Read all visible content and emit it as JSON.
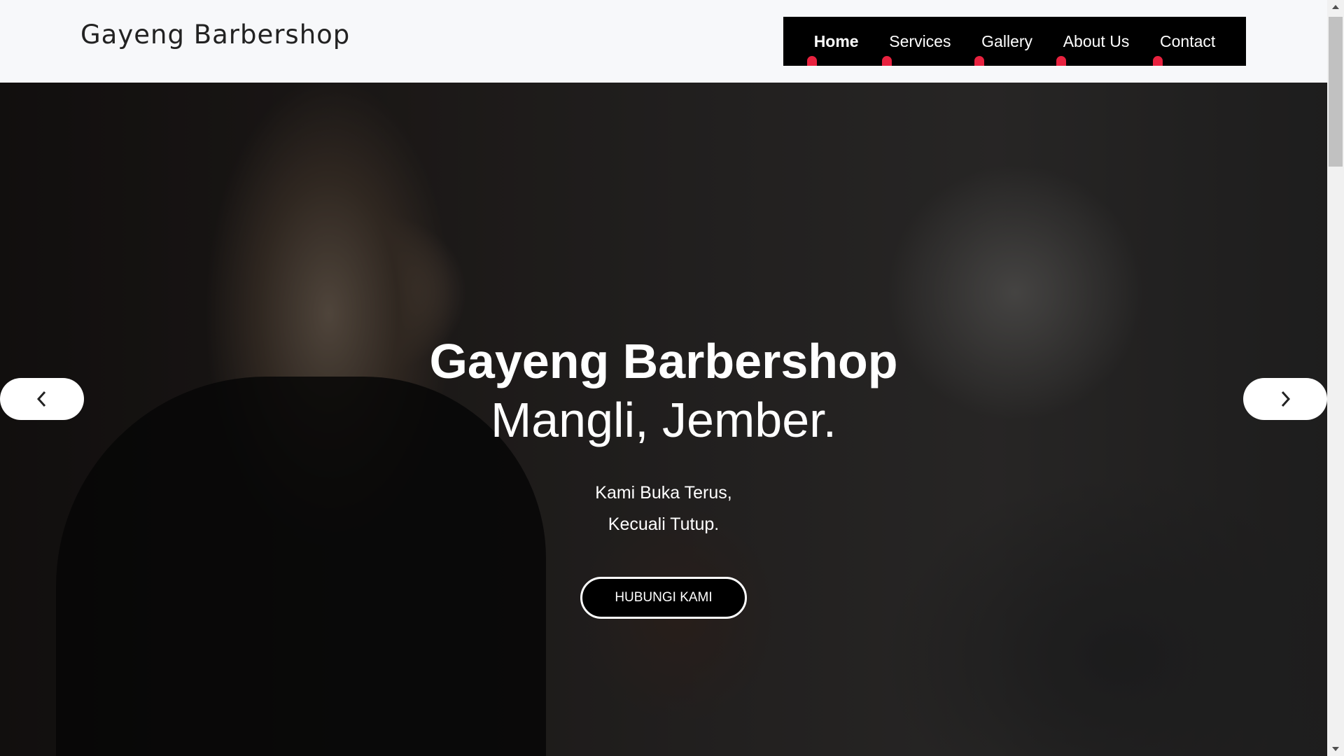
{
  "header": {
    "brand": "Gayeng Barbershop",
    "nav": [
      {
        "label": "Home",
        "active": true
      },
      {
        "label": "Services",
        "active": false
      },
      {
        "label": "Gallery",
        "active": false
      },
      {
        "label": "About Us",
        "active": false
      },
      {
        "label": "Contact",
        "active": false
      }
    ]
  },
  "hero": {
    "title": "Gayeng Barbershop",
    "subtitle": "Mangli, Jember.",
    "tagline_line1": "Kami Buka Terus,",
    "tagline_line2": "Kecuali Tutup.",
    "cta_label": "HUBUNGI KAMI",
    "prev_icon": "chevron-left-icon",
    "next_icon": "chevron-right-icon"
  },
  "colors": {
    "nav_bg": "#000000",
    "accent": "#e8223f",
    "header_bg": "#f7f8fa"
  }
}
